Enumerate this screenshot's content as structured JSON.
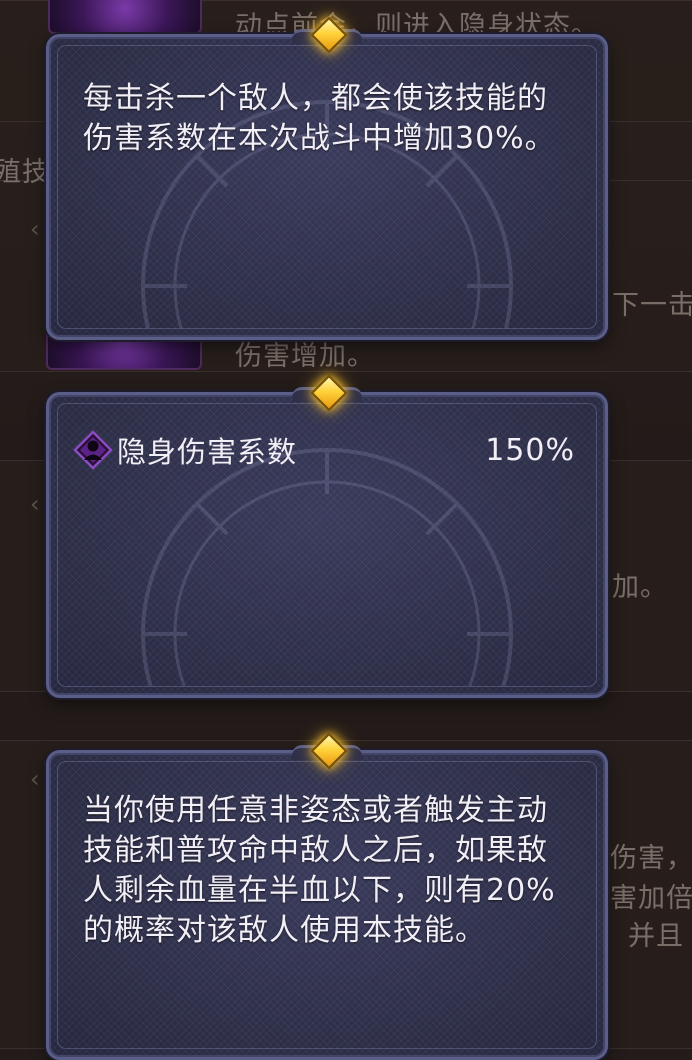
{
  "background": {
    "fragments": [
      "动点前会，则进入隐身状态。",
      "下一击",
      "伤害增加。",
      "加。",
      "伤害，",
      "害加倍",
      "并且",
      "殖技"
    ]
  },
  "tooltips": {
    "kill_bonus": {
      "text": "每击杀一个敌人，都会使该技能的伤害系数在本次战斗中增加30%。"
    },
    "stealth_damage": {
      "label": "隐身伤害系数",
      "value": "150%",
      "icon": "stealth-icon"
    },
    "trigger": {
      "text": "当你使用任意非姿态或者触发主动技能和普攻命中敌人之后，如果敌人剩余血量在半血以下，则有20%的概率对该敌人使用本技能。"
    }
  },
  "colors": {
    "card_fill": "#2e2f4a",
    "card_border": "#5a5e88",
    "gem": "#ffd23a",
    "text": "#f1eef6",
    "stat_icon": "#7a3aa8"
  }
}
